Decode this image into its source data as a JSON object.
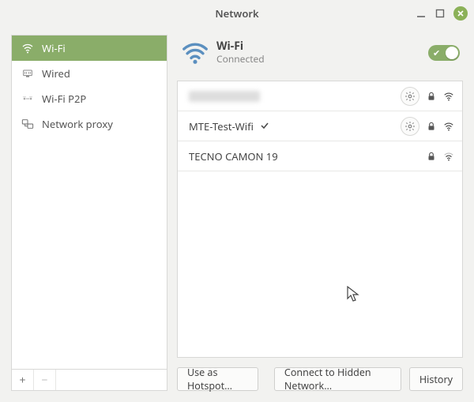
{
  "window": {
    "title": "Network"
  },
  "sidebar": {
    "items": [
      {
        "key": "wifi",
        "label": "Wi-Fi",
        "icon": "wifi-icon",
        "selected": true
      },
      {
        "key": "wired",
        "label": "Wired",
        "icon": "ethernet-icon",
        "selected": false
      },
      {
        "key": "wifi-p2p",
        "label": "Wi-Fi P2P",
        "icon": "p2p-icon",
        "selected": false
      },
      {
        "key": "proxy",
        "label": "Network proxy",
        "icon": "proxy-icon",
        "selected": false
      }
    ]
  },
  "header": {
    "title": "Wi-Fi",
    "subtitle": "Connected",
    "toggle_on": true
  },
  "networks": [
    {
      "name": "",
      "redacted": true,
      "connected": false,
      "has_settings": true,
      "secured": true,
      "signal": 4
    },
    {
      "name": "MTE-Test-Wifi",
      "redacted": false,
      "connected": true,
      "has_settings": true,
      "secured": true,
      "signal": 4
    },
    {
      "name": "TECNO CAMON 19",
      "redacted": false,
      "connected": false,
      "has_settings": false,
      "secured": true,
      "signal": 3
    }
  ],
  "footer": {
    "hotspot": "Use as Hotspot…",
    "hidden": "Connect to Hidden Network…",
    "history": "History"
  }
}
